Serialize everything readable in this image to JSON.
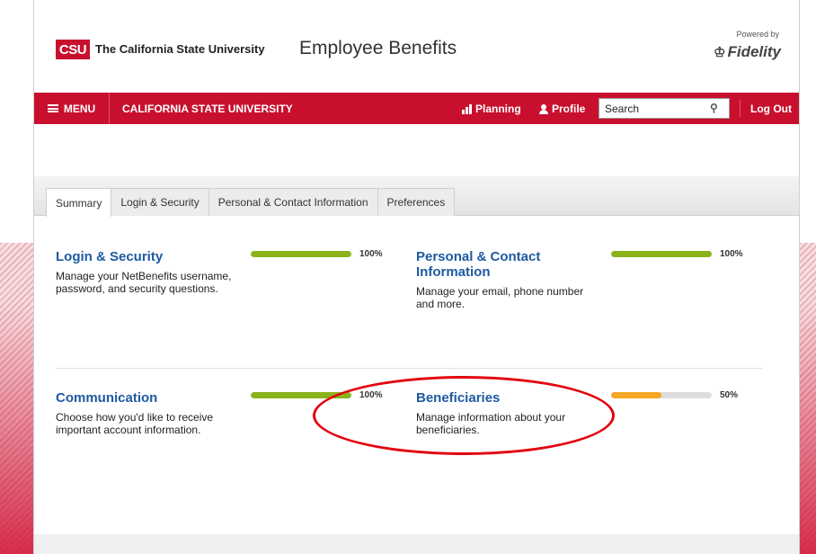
{
  "header": {
    "csu_logo": "CSU",
    "csu_name": "The California State University",
    "site_title": "Employee Benefits",
    "powered_by": "Powered by",
    "fidelity_logo": "Fidelity"
  },
  "navbar": {
    "menu_label": "MENU",
    "org_name": "CALIFORNIA STATE UNIVERSITY",
    "planning_label": "Planning",
    "profile_label": "Profile",
    "search_placeholder": "Search",
    "logout_label": "Log Out"
  },
  "tabs": [
    {
      "label": "Summary",
      "active": true
    },
    {
      "label": "Login & Security",
      "active": false
    },
    {
      "label": "Personal & Contact Information",
      "active": false
    },
    {
      "label": "Preferences",
      "active": false
    }
  ],
  "cards": {
    "login_security": {
      "title": "Login & Security",
      "description": "Manage your NetBenefits username, password, and security questions.",
      "progress": 1.0,
      "progress_label": "100%"
    },
    "personal_contact": {
      "title": "Personal & Contact Information",
      "description": "Manage your email, phone number and more.",
      "progress": 1.0,
      "progress_label": "100%"
    },
    "communication": {
      "title": "Communication",
      "description": "Choose how you'd like to receive important account information.",
      "progress": 1.0,
      "progress_label": "100%"
    },
    "beneficiaries": {
      "title": "Beneficiaries",
      "description": "Manage information about your beneficiaries.",
      "progress": 0.5,
      "progress_label": "50%"
    }
  },
  "colors": {
    "brand_red": "#c8102e",
    "link_blue": "#1e5aa0",
    "progress_complete": "#8ab31c",
    "progress_partial": "#f5a623",
    "annotation_red": "#e3000f"
  },
  "icons": {
    "menu": "hamburger-icon",
    "planning": "bar-chart-icon",
    "profile": "person-icon",
    "search": "search-icon",
    "fidelity": "fidelity-logo-icon"
  }
}
